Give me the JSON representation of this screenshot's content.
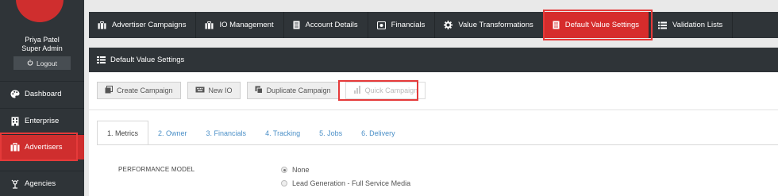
{
  "sidebar": {
    "user_name": "Priya Patel",
    "user_role": "Super Admin",
    "logout_label": "Logout",
    "items": [
      {
        "label": "Dashboard",
        "icon": "palette-icon"
      },
      {
        "label": "Enterprise",
        "icon": "building-icon"
      },
      {
        "label": "Advertisers",
        "icon": "briefcase-icon",
        "active": true
      },
      {
        "label": "Agencies",
        "icon": "agency-icon"
      }
    ]
  },
  "topnav": {
    "items": [
      {
        "label": "Advertiser Campaigns",
        "icon": "briefcase-icon"
      },
      {
        "label": "IO Management",
        "icon": "briefcase-icon"
      },
      {
        "label": "Account Details",
        "icon": "document-icon"
      },
      {
        "label": "Financials",
        "icon": "safe-icon"
      },
      {
        "label": "Value Transformations",
        "icon": "gear-icon"
      },
      {
        "label": "Default Value Settings",
        "icon": "document-icon",
        "active": true
      },
      {
        "label": "Validation Lists",
        "icon": "list-icon"
      }
    ]
  },
  "section": {
    "title": "Default Value Settings"
  },
  "toolbar": {
    "create_campaign": "Create Campaign",
    "new_io": "New IO",
    "duplicate_campaign": "Duplicate Campaign",
    "quick_campaign": "Quick Campaign"
  },
  "tabs": [
    {
      "label": "1. Metrics",
      "active": true
    },
    {
      "label": "2. Owner"
    },
    {
      "label": "3. Financials"
    },
    {
      "label": "4. Tracking"
    },
    {
      "label": "5. Jobs"
    },
    {
      "label": "6. Delivery"
    }
  ],
  "form": {
    "performance_model_label": "PERFORMANCE MODEL",
    "options": [
      {
        "label": "None",
        "checked": true
      },
      {
        "label": "Lead Generation - Full Service Media",
        "checked": false
      }
    ]
  },
  "colors": {
    "accent": "#d62c2c",
    "dark": "#2f3438",
    "link": "#4a8fc7",
    "highlight": "#e53a3a"
  }
}
